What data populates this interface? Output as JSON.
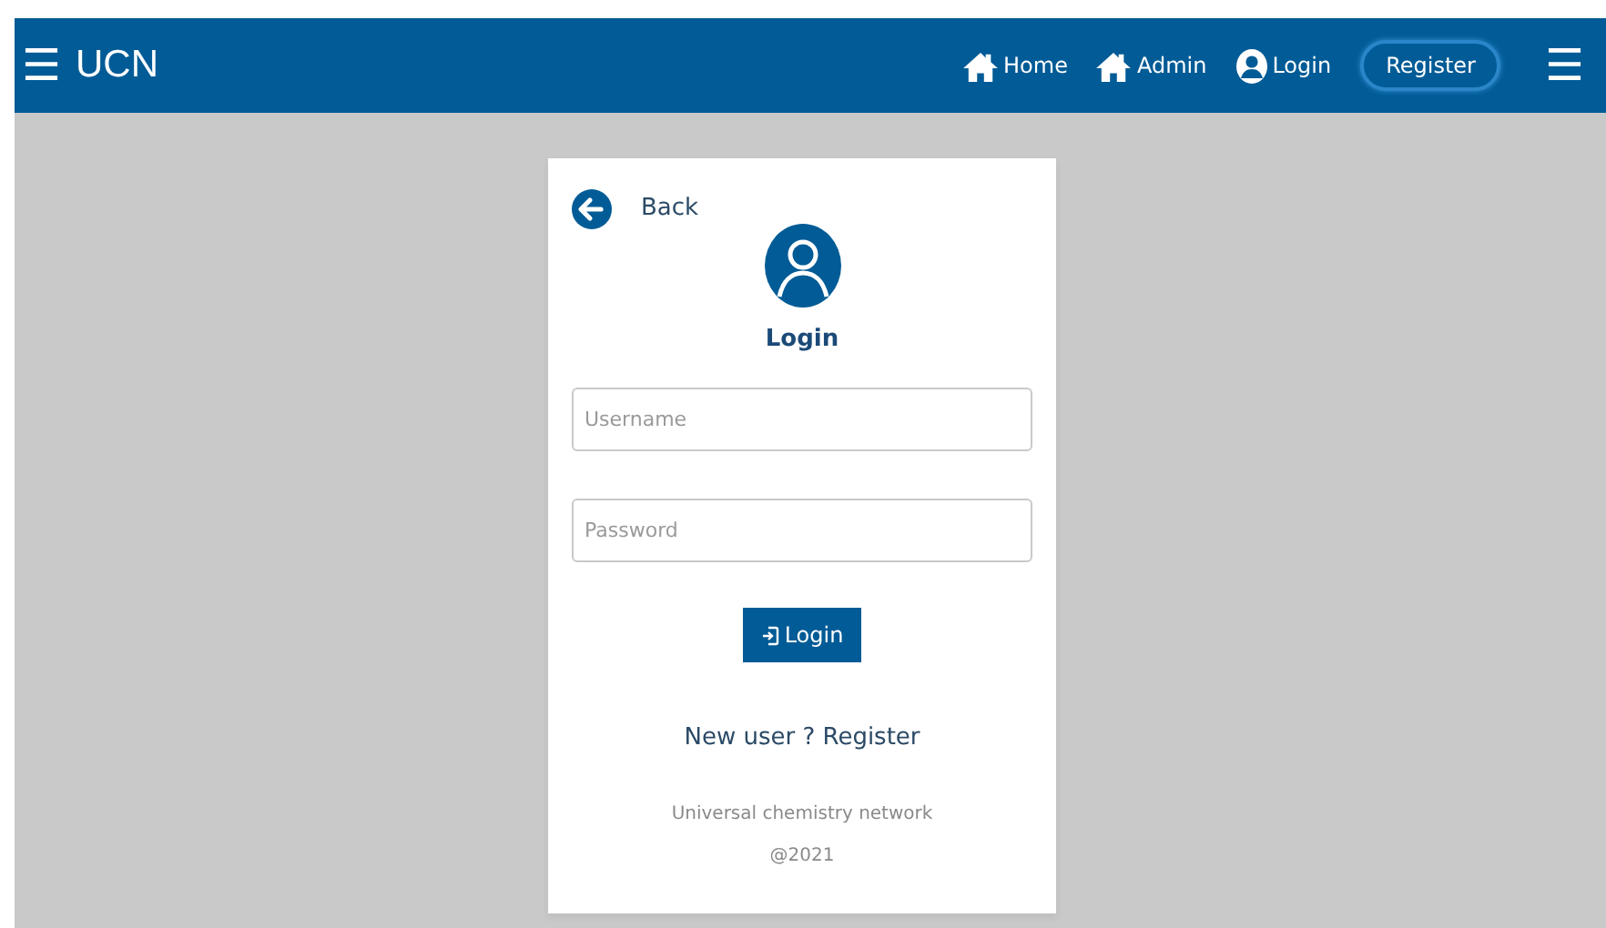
{
  "navbar": {
    "brand": "UCN",
    "menu_icon": "☰",
    "links": [
      {
        "label": "Home",
        "kind": "home"
      },
      {
        "label": "Admin",
        "kind": "home"
      },
      {
        "label": "Login",
        "kind": "user"
      }
    ],
    "register_button": "Register",
    "end_menu_icon": "☰"
  },
  "login_card": {
    "back": "Back",
    "title": "Login",
    "fields": [
      {
        "placeholder": "Username"
      },
      {
        "placeholder": "Password"
      }
    ],
    "submit": "Login",
    "signup_link": "New user ? Register",
    "footer": [
      "Universal chemistry network",
      "@2021"
    ]
  }
}
